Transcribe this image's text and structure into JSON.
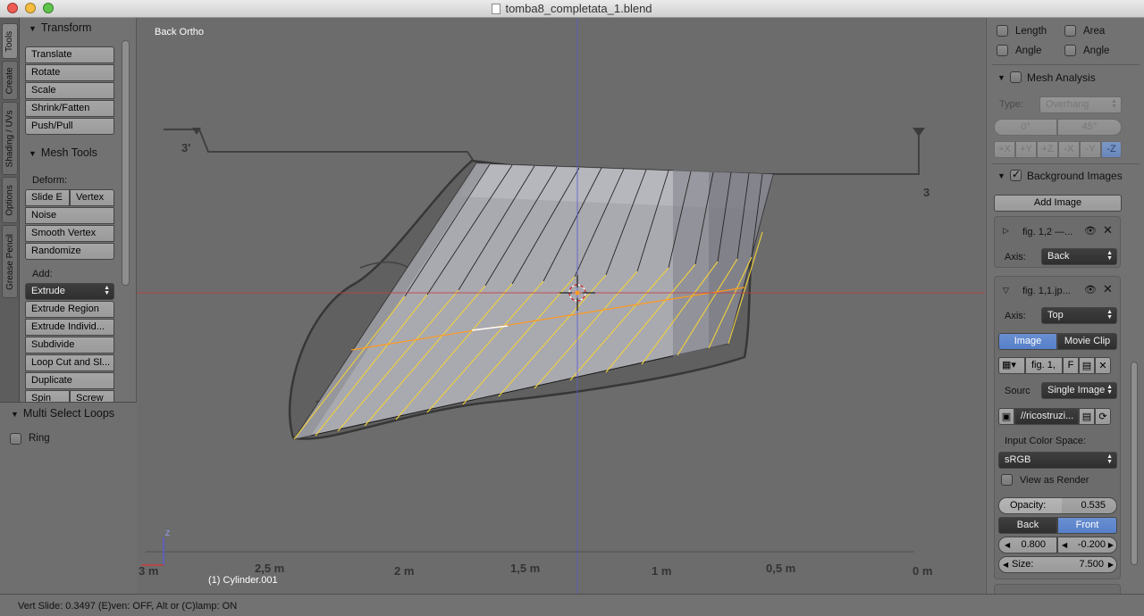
{
  "window": {
    "title": "tomba8_completata_1.blend"
  },
  "tabs": [
    "Tools",
    "Create",
    "Shading / UVs",
    "Options",
    "Grease Pencil"
  ],
  "toolshelf": {
    "transform_header": "Transform",
    "transform_buttons": [
      "Translate",
      "Rotate",
      "Scale",
      "Shrink/Fatten",
      "Push/Pull"
    ],
    "mesh_tools_header": "Mesh Tools",
    "deform_label": "Deform:",
    "slide_edge": "Slide E",
    "vertex": "Vertex",
    "deform_buttons": [
      "Noise",
      "Smooth Vertex",
      "Randomize"
    ],
    "add_label": "Add:",
    "extrude_select": "Extrude",
    "add_buttons": [
      "Extrude Region",
      "Extrude Individ...",
      "Subdivide",
      "Loop Cut and Sl...",
      "Duplicate"
    ],
    "spin": "Spin",
    "screw": "Screw"
  },
  "operator_panel": {
    "header": "Multi Select Loops",
    "ring_label": "Ring",
    "ring_checked": false
  },
  "viewport": {
    "view_name": "Back Ortho",
    "object_name": "(1) Cylinder.001",
    "ruler_labels": [
      "3 m",
      "2,5 m",
      "2 m",
      "1,5 m",
      "1 m",
      "0,5 m",
      "0 m"
    ],
    "section_labels": [
      "3'",
      "3"
    ],
    "axis_z": "Z"
  },
  "properties": {
    "measure": {
      "length": "Length",
      "area": "Area",
      "angle1": "Angle",
      "angle2": "Angle"
    },
    "mesh_analysis": {
      "header": "Mesh Analysis",
      "type_label": "Type:",
      "type_value": "Overhang",
      "min_value": "0°",
      "max_value": "45°",
      "axes": [
        "+X",
        "+Y",
        "+Z",
        "-X",
        "-Y",
        "-Z"
      ],
      "active_axis": "-Z"
    },
    "background_images": {
      "header": "Background Images",
      "enabled": true,
      "add_image": "Add Image",
      "image1": {
        "name": "fig. 1,2 —...",
        "axis_label": "Axis:",
        "axis_value": "Back"
      },
      "image2": {
        "name": "fig. 1,1.jp...",
        "axis_label": "Axis:",
        "axis_value": "Top",
        "tab_image": "Image",
        "tab_movie_clip": "Movie Clip",
        "file_name": "fig. 1,",
        "fake_user": "F",
        "source_label": "Sourc",
        "source_value": "Single Image",
        "filepath": "//ricostruzi...",
        "color_space_label": "Input Color Space:",
        "color_space_value": "sRGB",
        "view_as_render": "View as Render",
        "opacity_label": "Opacity:",
        "opacity_value": "0.535",
        "back": "Back",
        "front": "Front",
        "offset_x": "0.800",
        "offset_y": "-0.200",
        "size_label": "Size:",
        "size_value": "7.500"
      }
    }
  },
  "status": {
    "text": "Vert Slide: 0.3497 (E)ven: OFF, Alt or (C)lamp: ON"
  },
  "colors": {
    "viewport_bg": "#6c6c6c",
    "selected_edge": "#f0d23c",
    "active_edge": "#ff9a1e",
    "x_axis": "#c83c3c",
    "z_axis": "#5a5ad2",
    "toggle_blue": "#5680c9"
  }
}
